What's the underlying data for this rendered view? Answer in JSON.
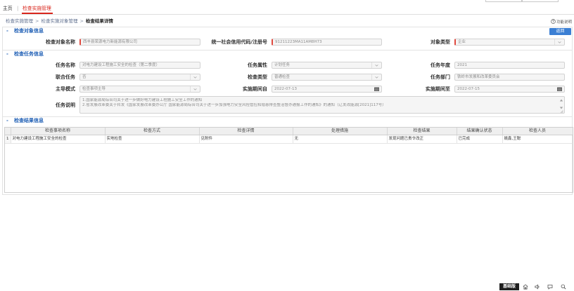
{
  "topnav": {
    "home": "主页",
    "separator": "|",
    "active_tab": "检查实施管理"
  },
  "breadcrumb": {
    "items": [
      "检查实施管理",
      "检查实施对象管理",
      "检查结果详情"
    ],
    "separator": ">"
  },
  "help": {
    "label": "功能说明",
    "icon": "question-circle-icon"
  },
  "colors": {
    "accent": "#1f5fb5",
    "active": "#d9261c",
    "btn": "#3b7fd4",
    "badge": "#1f1f1f",
    "required": "#e04a3f"
  },
  "object_section": {
    "toggle": "-",
    "title": "检查对象信息",
    "back_button": "返回",
    "fields": {
      "name": {
        "label": "检查对象名称",
        "value": "西丰县荣源电力新能源有限公司"
      },
      "credit_code": {
        "label": "统一社会信用代码/注册号",
        "value": "91211223MA11AM8H73"
      },
      "object_type": {
        "label": "对象类型",
        "value": "企业",
        "icon": "chevron-down-icon"
      }
    }
  },
  "task_section": {
    "toggle": "-",
    "title": "检查任务信息",
    "fields": {
      "task_name": {
        "label": "任务名称",
        "value": "对电力建设工程施工安全的检查（第二季度）"
      },
      "task_attribute": {
        "label": "任务属性",
        "value": "计划任务",
        "icon": "chevron-down-icon"
      },
      "task_year": {
        "label": "任务年度",
        "value": "2021"
      },
      "joint_task": {
        "label": "联合任务",
        "value": "否",
        "icon": "chevron-down-icon"
      },
      "check_type": {
        "label": "检查类型",
        "value": "普通检查",
        "icon": "chevron-down-icon"
      },
      "task_department": {
        "label": "任务部门",
        "value": "铁岭市发展和改革委员会"
      },
      "lead_mode": {
        "label": "主导模式",
        "value": "检查事项主导",
        "icon": "chevron-down-icon"
      },
      "period_from": {
        "label": "实施期间自",
        "value": "2022-07-13",
        "icon": "calendar-icon"
      },
      "period_to": {
        "label": "实施期间至",
        "value": "2022-07-15",
        "icon": "calendar-icon"
      },
      "description": {
        "label": "任务说明",
        "lines": [
          "1.国家能源局综合司关于进一步做好电力建设工程施工安全工作的通知",
          "2.省发展改革委关于转发《国家发展改革委办公厅 国家能源局综合司关于进一步加强电力安全风险管控和隐患排查整治督办通报工作的通知》的通知（辽发改能源[2021]117号）"
        ]
      }
    }
  },
  "result_section": {
    "toggle": "-",
    "title": "检查结果信息",
    "table": {
      "headers": [
        "检查事项名称",
        "检查方式",
        "检查详情",
        "处理措施",
        "检查结果",
        "结果确认状态",
        "检查人员"
      ],
      "rows": [
        {
          "index": "1",
          "item_name": "对电力建设工程施工安全的检查",
          "method": "实地检查",
          "detail": "见附件",
          "measures": "无",
          "result": "发现问题已责令改正",
          "confirm_status": "已完成",
          "inspectors": "姚鑫,王聪"
        }
      ]
    }
  },
  "statusbar": {
    "badge": "基础版",
    "icons": [
      "home-icon",
      "speaker-icon",
      "chat-icon",
      "search-icon"
    ]
  }
}
